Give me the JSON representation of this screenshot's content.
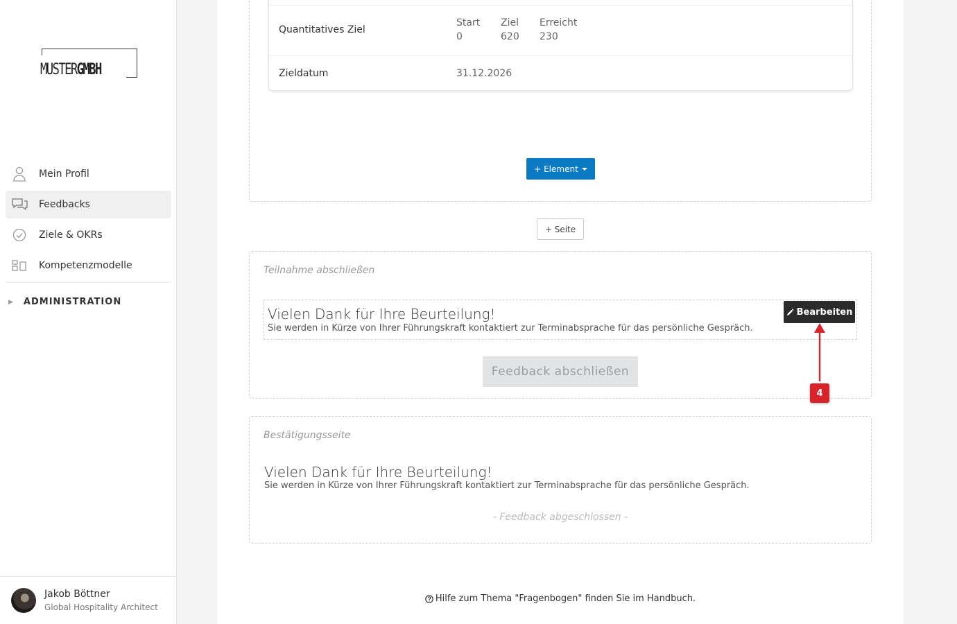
{
  "sidebar": {
    "logo": {
      "part1": "MUSTER",
      "part2": "GMBH"
    },
    "items": [
      {
        "label": "Mein Profil",
        "icon": "user-icon"
      },
      {
        "label": "Feedbacks",
        "icon": "chat-icon"
      },
      {
        "label": "Ziele & OKRs",
        "icon": "check-circle-icon"
      },
      {
        "label": "Kompetenzmodelle",
        "icon": "grid-icon"
      }
    ],
    "admin_label": "ADMINISTRATION",
    "user": {
      "name": "Jakob Böttner",
      "role": "Global Hospitality Architect"
    }
  },
  "goal_card": {
    "quant_label": "Quantitatives Ziel",
    "start_label": "Start",
    "start_value": "0",
    "target_label": "Ziel",
    "target_value": "620",
    "reached_label": "Erreicht",
    "reached_value": "230",
    "date_label": "Zieldatum",
    "date_value": "31.12.2026"
  },
  "toolbar": {
    "add_element": "+ Element",
    "add_page": "+ Seite"
  },
  "finish_section": {
    "title": "Teilnahme abschließen",
    "thanks": "Vielen Dank für Ihre Beurteilung!",
    "subtext": "Sie werden in Kürze von Ihrer Führungskraft kontaktiert zur Terminabsprache für das persönliche Gespräch.",
    "edit_label": "Bearbeiten",
    "submit_label": "Feedback abschließen"
  },
  "annotation": {
    "step": "4",
    "color": "#d8232a"
  },
  "confirm_section": {
    "title": "Bestätigungsseite",
    "thanks": "Vielen Dank für Ihre Beurteilung!",
    "subtext": "Sie werden in Kürze von Ihrer Führungskraft kontaktiert zur Terminabsprache für das persönliche Gespräch.",
    "done_label": "- Feedback abgeschlossen -"
  },
  "help": {
    "text": "Hilfe zum Thema \"Fragenbogen\" finden Sie im Handbuch."
  },
  "colors": {
    "primary": "#0b7ac4",
    "dark_button": "#2b2b2b",
    "accent_red": "#d8232a"
  }
}
